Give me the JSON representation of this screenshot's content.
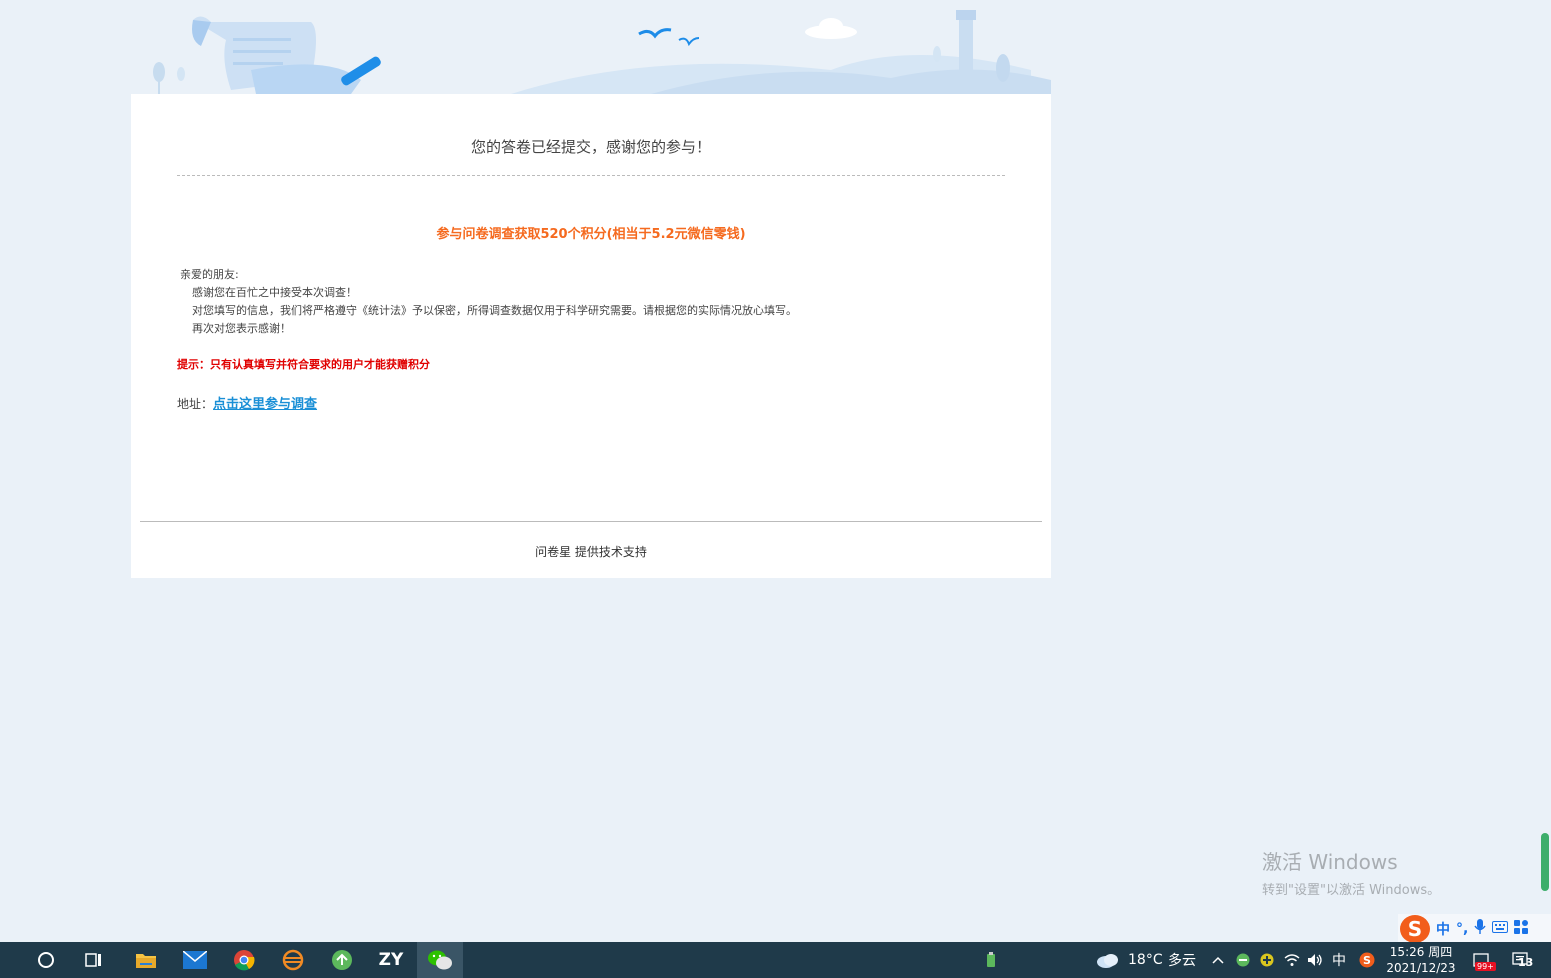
{
  "survey": {
    "thanks_message": "您的答卷已经提交，感谢您的参与！",
    "reward_text": "参与问卷调查获取520个积分(相当于5.2元微信零钱)",
    "letter": {
      "greeting": "亲爱的朋友:",
      "line1": "感谢您在百忙之中接受本次调查！",
      "line2": "对您填写的信息，我们将严格遵守《统计法》予以保密，所得调查数据仅用于科学研究需要。请根据您的实际情况放心填写。",
      "line3": "再次对您表示感谢！"
    },
    "tip": "提示：只有认真填写并符合要求的用户才能获赠积分",
    "address_label": "地址：",
    "address_link": "点击这里参与调查",
    "footer": "问卷星 提供技术支持"
  },
  "watermark": {
    "title": "激活 Windows",
    "subtitle": "转到\"设置\"以激活 Windows。"
  },
  "ime": {
    "logo": "S",
    "mode": "中",
    "punct": "°,"
  },
  "taskbar": {
    "weather_temp": "18°C",
    "weather_desc": "多云",
    "input_lang": "中",
    "time": "15:26 周四",
    "date": "2021/12/23",
    "mail_badge": "99+",
    "notification_count": "13",
    "zy_label": "ZY"
  },
  "colors": {
    "accent_orange": "#f56a1f",
    "tip_red": "#e00000",
    "link_blue": "#1a8fd6",
    "page_bg": "#eaf1f8",
    "taskbar_bg": "#1f3a4a"
  }
}
